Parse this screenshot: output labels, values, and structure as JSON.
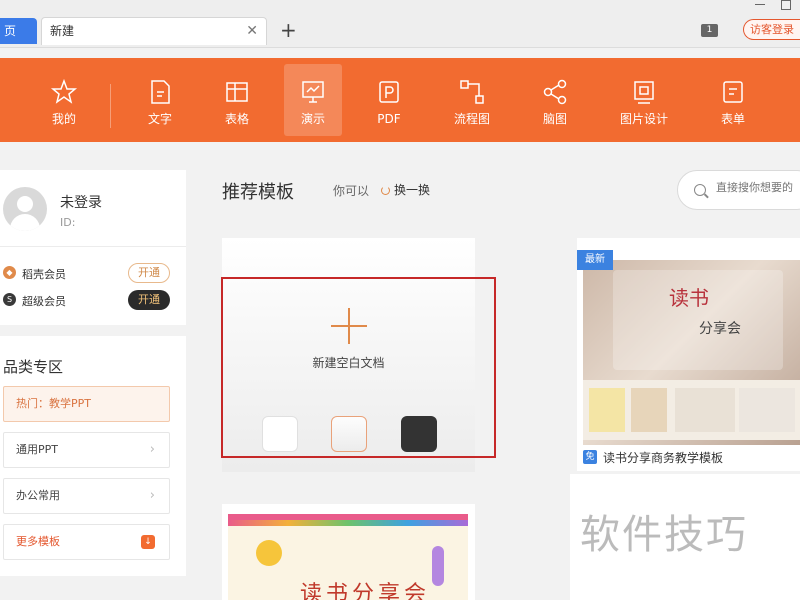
{
  "tabs": {
    "home_label": "首页",
    "home_visible": "页",
    "new_label": "新建",
    "close_glyph": "✕",
    "add_glyph": "+"
  },
  "window": {
    "square_badge": "1",
    "guest_login": "访客登录"
  },
  "toolbar": {
    "color": "#f26b30",
    "items": [
      {
        "label": "我的",
        "icon": "star-icon"
      },
      {
        "label": "文字",
        "icon": "document-icon"
      },
      {
        "label": "表格",
        "icon": "table-icon"
      },
      {
        "label": "演示",
        "icon": "presentation-icon",
        "active": true
      },
      {
        "label": "PDF",
        "icon": "pdf-icon"
      },
      {
        "label": "流程图",
        "icon": "flowchart-icon"
      },
      {
        "label": "脑图",
        "icon": "mindmap-icon"
      },
      {
        "label": "图片设计",
        "icon": "image-design-icon"
      },
      {
        "label": "表单",
        "icon": "form-icon"
      }
    ]
  },
  "user": {
    "name": "未登录",
    "id_label": "ID:",
    "members": [
      {
        "label": "稻壳会员",
        "button": "开通",
        "icon_color": "#e08a4a"
      },
      {
        "label": "超级会员",
        "button": "开通",
        "icon_color": "#3a3a3a"
      }
    ]
  },
  "categories": {
    "title": "品类专区",
    "items": [
      {
        "label": "热门：教学PPT"
      },
      {
        "label": "通用PPT"
      },
      {
        "label": "办公常用"
      },
      {
        "label": "更多模板"
      }
    ],
    "chevron": "›"
  },
  "main": {
    "section_title": "推荐模板",
    "hint": "你可以",
    "refresh_label": "换一换",
    "search_placeholder": "直接搜你想要的",
    "blank_label": "新建空白文档",
    "template": {
      "badge": "最新",
      "free_badge": "免",
      "name": "读书分享商务教学模板",
      "cover_title": "读书",
      "cover_subtitle": "分享会"
    },
    "card2_title": "读书分享会"
  },
  "watermark": "软件技巧"
}
